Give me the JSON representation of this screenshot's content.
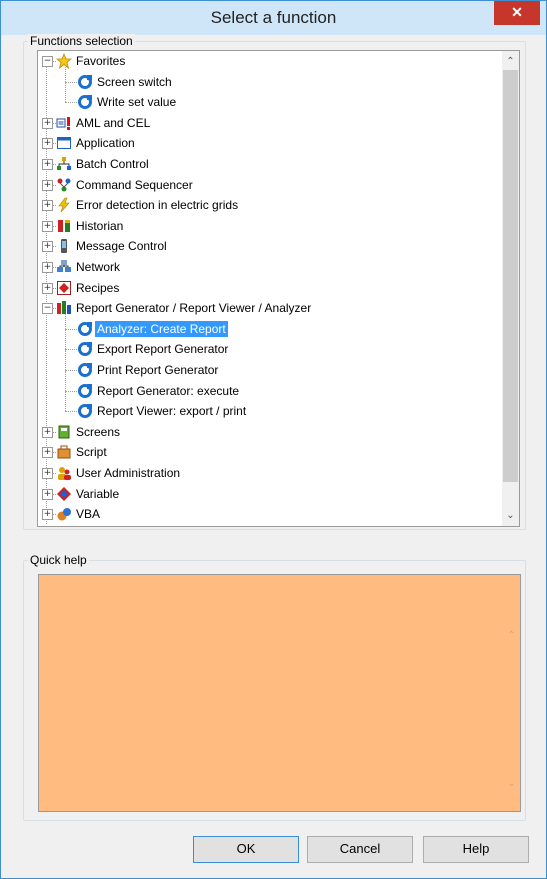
{
  "window": {
    "title": "Select a function",
    "close_glyph": "✕"
  },
  "functions_group": {
    "label": "Functions selection"
  },
  "tree": [
    {
      "label": "Favorites",
      "level": 0,
      "expanded": true,
      "icon": "star-icon"
    },
    {
      "label": "Screen switch",
      "level": 1,
      "icon": "function-icon"
    },
    {
      "label": "Write set value",
      "level": 1,
      "icon": "function-icon"
    },
    {
      "label": "AML and CEL",
      "level": 0,
      "expanded": false,
      "icon": "alarm-icon"
    },
    {
      "label": "Application",
      "level": 0,
      "expanded": false,
      "icon": "application-window-icon"
    },
    {
      "label": "Batch Control",
      "level": 0,
      "expanded": false,
      "icon": "batch-control-icon"
    },
    {
      "label": "Command Sequencer",
      "level": 0,
      "expanded": false,
      "icon": "command-sequencer-icon"
    },
    {
      "label": "Error detection in electric grids",
      "level": 0,
      "expanded": false,
      "icon": "lightning-icon"
    },
    {
      "label": "Historian",
      "level": 0,
      "expanded": false,
      "icon": "historian-icon"
    },
    {
      "label": "Message Control",
      "level": 0,
      "expanded": false,
      "icon": "message-control-icon"
    },
    {
      "label": "Network",
      "level": 0,
      "expanded": false,
      "icon": "network-icon"
    },
    {
      "label": "Recipes",
      "level": 0,
      "expanded": false,
      "icon": "recipes-icon"
    },
    {
      "label": "Report Generator / Report Viewer / Analyzer",
      "level": 0,
      "expanded": true,
      "icon": "report-icon"
    },
    {
      "label": "Analyzer: Create Report",
      "level": 1,
      "icon": "function-icon",
      "selected": true
    },
    {
      "label": "Export Report Generator",
      "level": 1,
      "icon": "function-icon"
    },
    {
      "label": "Print Report Generator",
      "level": 1,
      "icon": "function-icon"
    },
    {
      "label": "Report Generator: execute",
      "level": 1,
      "icon": "function-icon"
    },
    {
      "label": "Report Viewer: export / print",
      "level": 1,
      "icon": "function-icon"
    },
    {
      "label": "Screens",
      "level": 0,
      "expanded": false,
      "icon": "screens-icon"
    },
    {
      "label": "Script",
      "level": 0,
      "expanded": false,
      "icon": "script-icon"
    },
    {
      "label": "User Administration",
      "level": 0,
      "expanded": false,
      "icon": "user-administration-icon"
    },
    {
      "label": "Variable",
      "level": 0,
      "expanded": false,
      "icon": "variable-icon"
    },
    {
      "label": "VBA",
      "level": 0,
      "expanded": false,
      "icon": "vba-icon"
    }
  ],
  "help_group": {
    "label": "Quick help",
    "text": ""
  },
  "buttons": {
    "ok": "OK",
    "cancel": "Cancel",
    "help": "Help"
  },
  "colors": {
    "help_background": "#ffbb80",
    "selection": "#3399ff",
    "close_button": "#c7362b",
    "titlebar": "#cfe6f8"
  }
}
